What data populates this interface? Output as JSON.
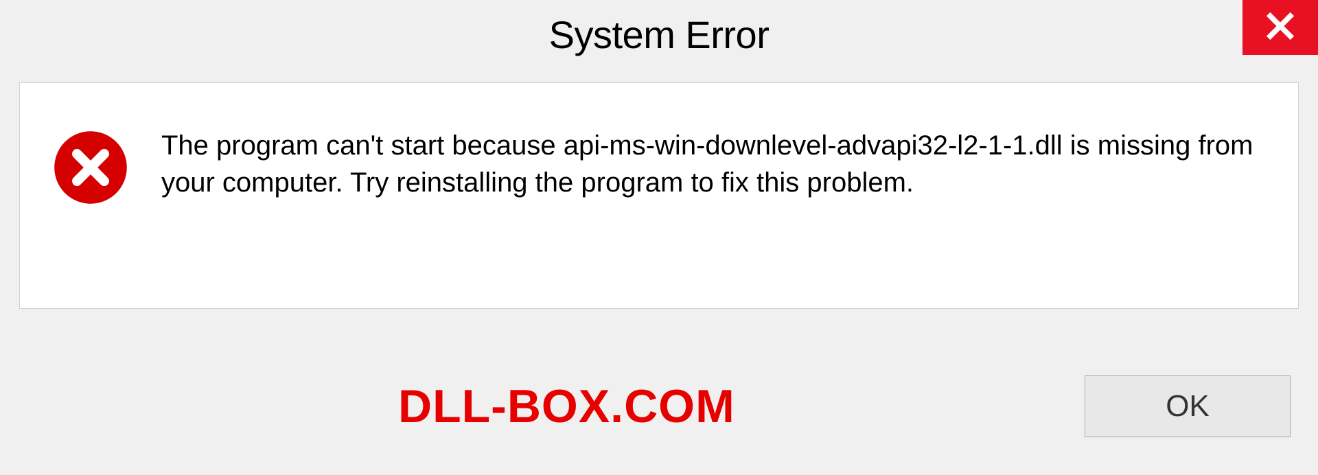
{
  "dialog": {
    "title": "System Error",
    "message": "The program can't start because api-ms-win-downlevel-advapi32-l2-1-1.dll is missing from your computer. Try reinstalling the program to fix this problem.",
    "ok_label": "OK"
  },
  "watermark": "DLL-BOX.COM",
  "colors": {
    "close_bg": "#e81123",
    "error_icon": "#d50000",
    "watermark": "#e60000"
  }
}
